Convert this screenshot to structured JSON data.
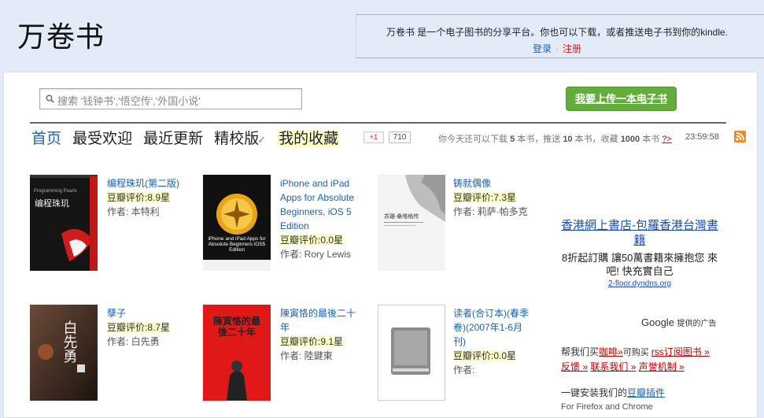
{
  "header": {
    "logo": "万卷书",
    "intro": "万卷书 是一个电子图书的分享平台。你也可以下载，或者推送电子书到你的kindle.",
    "login": "登录",
    "separator": "·",
    "register": "注册"
  },
  "search": {
    "placeholder": "搜索 '钱钟书','悟空传','外国小说'"
  },
  "upload_button": "我要上传一本电子书",
  "nav": {
    "home": "首页",
    "popular": "最受欢迎",
    "recent": "最近更新",
    "refined": "精校版",
    "check": "✓",
    "favorites": "我的收藏"
  },
  "social": {
    "gplus": "+1",
    "count": "710"
  },
  "quota": {
    "p1": "你今天还可以下载 ",
    "downloads": "5",
    "p2": " 本书，推送 ",
    "pushes": "10",
    "p3": " 本书，收藏 ",
    "favorites": "1000",
    "p4": " 本书 ",
    "help": "?>"
  },
  "clock": "23:59:58",
  "books": [
    {
      "title": "编程珠玑(第二版)",
      "rating": "豆瓣评价:8.9星",
      "author": "作者: 本特利",
      "cover_text": "编程珠玑",
      "cover_en": "Programming Pearls"
    },
    {
      "title": "iPhone and iPad Apps for Absolute Beginners, iOS 5 Edition",
      "rating": "豆瓣评价:0.0星",
      "author": "作者: Rory Lewis",
      "cover_text": "iPhone and iPad Apps for Absolute Beginners iOS5 Edition"
    },
    {
      "title": "铸就偶像",
      "rating": "豆瓣评价:7.3星",
      "author": "作者: 莉萨·帕多克",
      "cover_text": "苏珊·桑塔格传"
    },
    {
      "title": "孽子",
      "rating": "豆瓣评价:8.7星",
      "author": "作者: 白先勇",
      "cover_text": "白先勇"
    },
    {
      "title": "陳寅恪的最後二十年",
      "rating": "豆瓣评价:9.1星",
      "author": "作者: 陸鍵東",
      "cover_text": "陳寅恪的最後二十年"
    },
    {
      "title": "读者(合订本)(春季卷)(2007年1-6月刊)",
      "rating": "豆瓣评价:0.0星",
      "author": "作者:"
    }
  ],
  "ad": {
    "title": "香港網上書店-包羅香港台灣書籍",
    "desc": "8折起訂購 讓50萬書籍來擁抱您 來吧! 快充實自己",
    "url": "2-floor.dyndns.org",
    "google": "Google",
    "google_sub": "提供的广告"
  },
  "help": {
    "p1": "帮我们买",
    "coffee": "咖啡»",
    "p2": "可购买 ",
    "rss": "rss订阅图书 »",
    "feedback": "反馈 »",
    "contact": "联系我们 »",
    "statement": "声誉机制 »"
  },
  "plugin": {
    "p1": "一键安装我们的",
    "link": "豆瓣插件",
    "sub": "For Firefox and Chrome"
  },
  "colors": {
    "accent": "#1a62b5",
    "upload_green": "#63ad3c",
    "rating_bg": "#fcfcc8",
    "page_bg": "#e3ebf8"
  }
}
